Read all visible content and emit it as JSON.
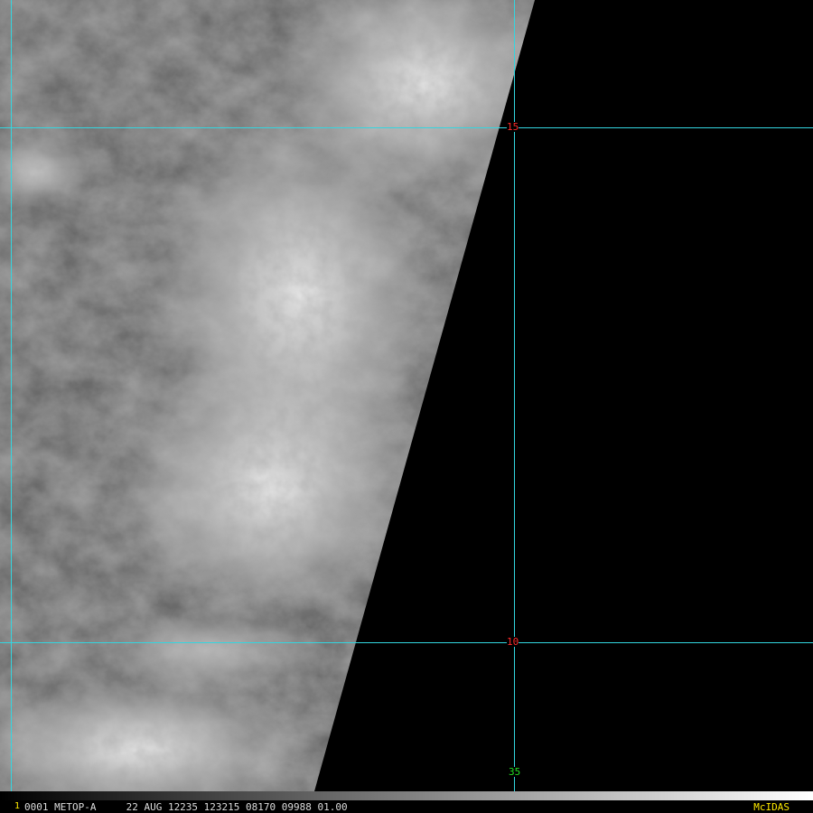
{
  "image": {
    "satellite": "METOP-A",
    "frame_number": "1",
    "status_line": "0001 METOP-A     22 AUG 12235 123215 08170 09988 01.00",
    "brand": "McIDAS"
  },
  "grid": {
    "latitude_labels": [
      "15",
      "10"
    ],
    "longitude_labels": [
      "35"
    ],
    "line_color": "#33d6e0",
    "lat_label_color": "#ff2a2a",
    "lon_label_color": "#22dd22"
  },
  "colors": {
    "background": "#000000",
    "status_text": "#dddddd",
    "brand_text": "#ffea00"
  }
}
